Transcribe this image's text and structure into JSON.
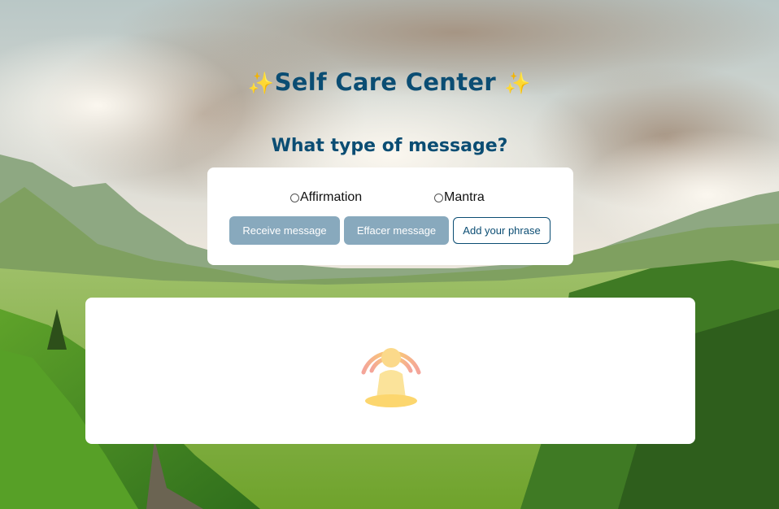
{
  "header": {
    "sparkle_left": "✨",
    "title": "Self Care Center",
    "sparkle_right": "✨"
  },
  "question": "What type of message?",
  "options": {
    "affirmation": "Affirmation",
    "mantra": "Mantra"
  },
  "buttons": {
    "receive": "Receive message",
    "effacer": "Effacer message",
    "add": "Add your phrase"
  },
  "message_area": {
    "icon": "meditation-icon"
  },
  "colors": {
    "title": "#0b4d73",
    "button_fill": "#88a9bd",
    "sparkle": "#f6c92d"
  }
}
